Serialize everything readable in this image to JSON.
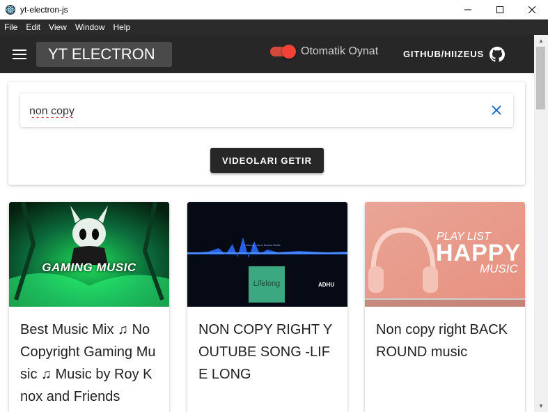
{
  "window": {
    "title": "yt-electron-js",
    "minimize_glyph": "—",
    "maximize_glyph": "☐",
    "close_glyph": "✕"
  },
  "menubar": {
    "items": [
      "File",
      "Edit",
      "View",
      "Window",
      "Help"
    ]
  },
  "appbar": {
    "brand": "YT ELECTRON",
    "autoplay_label": "Otomatik Oynat",
    "autoplay_on": true,
    "github_label": "GITHUB/HIIZEUS"
  },
  "search": {
    "value": "non copy",
    "button_label": "VIDEOLARI GETIR"
  },
  "videos": [
    {
      "title": "Best Music Mix ♫ No Copyright Gaming Music ♫ Music by Roy Knox and Friends",
      "thumb_text": "GAMING MUSIC"
    },
    {
      "title": "NON COPY RIGHT YOUTUBE SONG -LIFE LONG",
      "thumb_text": "Lifelong",
      "thumb_small_text": "Lifelong - Anno Domini Beats",
      "thumb_corner_text": "ADHU"
    },
    {
      "title": "Non copy right BACKROUND music",
      "thumb_text_1": "PLAY LIST",
      "thumb_text_2": "HAPPY",
      "thumb_text_3": "MUSIC"
    }
  ],
  "colors": {
    "appbar": "#272727",
    "menubar": "#2b2b2b",
    "accent_red": "#f44336",
    "clear_icon": "#1e6fd0"
  }
}
